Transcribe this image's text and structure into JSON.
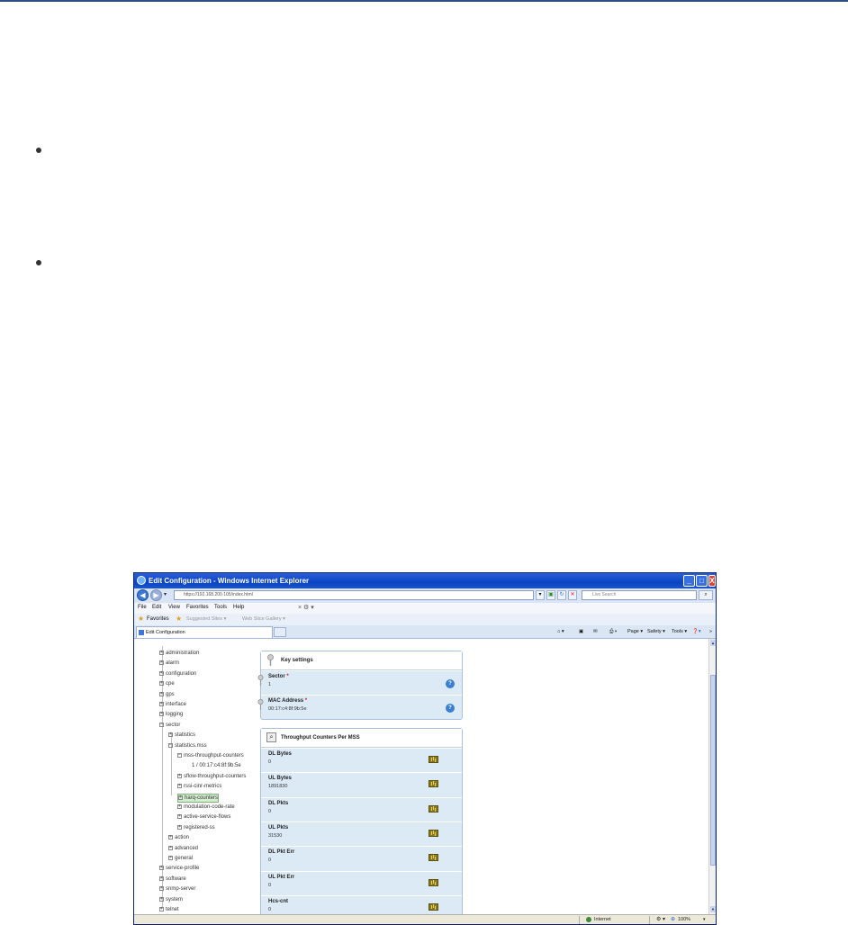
{
  "window": {
    "title": "Edit Configuration - Windows Internet Explorer",
    "controls": [
      "_",
      "□",
      "X"
    ]
  },
  "address": {
    "url": "https://192.168.200.105/index.html",
    "search_placeholder": "Live Search"
  },
  "menu": [
    "File",
    "Edit",
    "View",
    "Favorites",
    "Tools",
    "Help"
  ],
  "favorites": {
    "label": "Favorites",
    "links": [
      "Suggested Sites ▾",
      "Web Slice Gallery ▾"
    ]
  },
  "tab": {
    "label": "Edit Configuration"
  },
  "command_bar": [
    "Page ▾",
    "Safety ▾",
    "Tools ▾"
  ],
  "tree": [
    {
      "label": "administration",
      "sign": "+"
    },
    {
      "label": "alarm",
      "sign": "+"
    },
    {
      "label": "configuration",
      "sign": "+"
    },
    {
      "label": "cpe",
      "sign": "+"
    },
    {
      "label": "gps",
      "sign": "+"
    },
    {
      "label": "interface",
      "sign": "+"
    },
    {
      "label": "logging",
      "sign": "+"
    },
    {
      "label": "sector",
      "sign": "−"
    },
    {
      "label": "statistics",
      "sign": "+"
    },
    {
      "label": "statistics.mss",
      "sign": "−"
    },
    {
      "label": "mss-throughput-counters",
      "sign": "−"
    },
    {
      "label": "1 / 00:17:c4:8f:9b:5e",
      "sign": ""
    },
    {
      "label": "sflow-throughput-counters",
      "sign": "+"
    },
    {
      "label": "rssi-cinr-metrics",
      "sign": "+"
    },
    {
      "label": "harq-counters",
      "sign": "+"
    },
    {
      "label": "modulation-code-rate",
      "sign": "+"
    },
    {
      "label": "active-service-flows",
      "sign": "+"
    },
    {
      "label": "registered-ss",
      "sign": "+"
    },
    {
      "label": "action",
      "sign": "+"
    },
    {
      "label": "advanced",
      "sign": "+"
    },
    {
      "label": "general",
      "sign": "+"
    },
    {
      "label": "service-profile",
      "sign": "+"
    },
    {
      "label": "software",
      "sign": "+"
    },
    {
      "label": "snmp-server",
      "sign": "+"
    },
    {
      "label": "system",
      "sign": "+"
    },
    {
      "label": "telnet",
      "sign": "+"
    }
  ],
  "key_settings": {
    "title": "Key settings",
    "fields": [
      {
        "label": "Sector",
        "required": "*",
        "value": "1"
      },
      {
        "label": "MAC Address",
        "required": "*",
        "value": "00:17:c4:8f:9b:5e"
      }
    ]
  },
  "counters": {
    "title": "Throughput Counters Per MSS",
    "rows": [
      {
        "label": "DL Bytes",
        "value": "0"
      },
      {
        "label": "UL Bytes",
        "value": "1891830"
      },
      {
        "label": "DL Pkts",
        "value": "0"
      },
      {
        "label": "UL Pkts",
        "value": "31530"
      },
      {
        "label": "DL Pkt Err",
        "value": "0"
      },
      {
        "label": "UL Pkt Err",
        "value": "0"
      },
      {
        "label": "Hcs-cnt",
        "value": "0"
      }
    ]
  },
  "status": {
    "zone": "Internet",
    "zoom": "100%"
  }
}
